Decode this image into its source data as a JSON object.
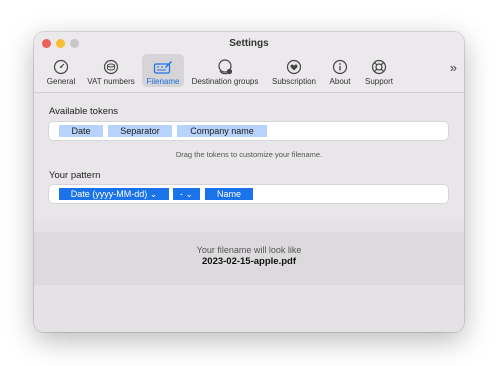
{
  "window": {
    "title": "Settings"
  },
  "toolbar": {
    "items": [
      {
        "label": "General",
        "icon": "speedometer-icon"
      },
      {
        "label": "VAT numbers",
        "icon": "coins-icon"
      },
      {
        "label": "Filename",
        "icon": "keyboard-pen-icon",
        "active": true
      },
      {
        "label": "Destination groups",
        "icon": "folder-badge-icon"
      },
      {
        "label": "Subscription",
        "icon": "heart-circle-icon"
      },
      {
        "label": "About",
        "icon": "info-circle-icon"
      },
      {
        "label": "Support",
        "icon": "lifebuoy-icon"
      }
    ],
    "overflow_label": "»"
  },
  "tokens": {
    "label": "Available tokens",
    "items": [
      "Date",
      "Separator",
      "Company name"
    ],
    "hint": "Drag the tokens to customize your filename."
  },
  "pattern": {
    "label": "Your pattern",
    "date_token": "Date (yyyy-MM-dd)",
    "separator_token": "-",
    "name_token": "Name"
  },
  "preview": {
    "caption": "Your filename will look like",
    "filename": "2023-02-15-apple.pdf"
  },
  "colors": {
    "accent": "#1a73e8",
    "token_bg": "#b7d3fb",
    "close": "#ee5f58",
    "minimize": "#f6be2f"
  }
}
